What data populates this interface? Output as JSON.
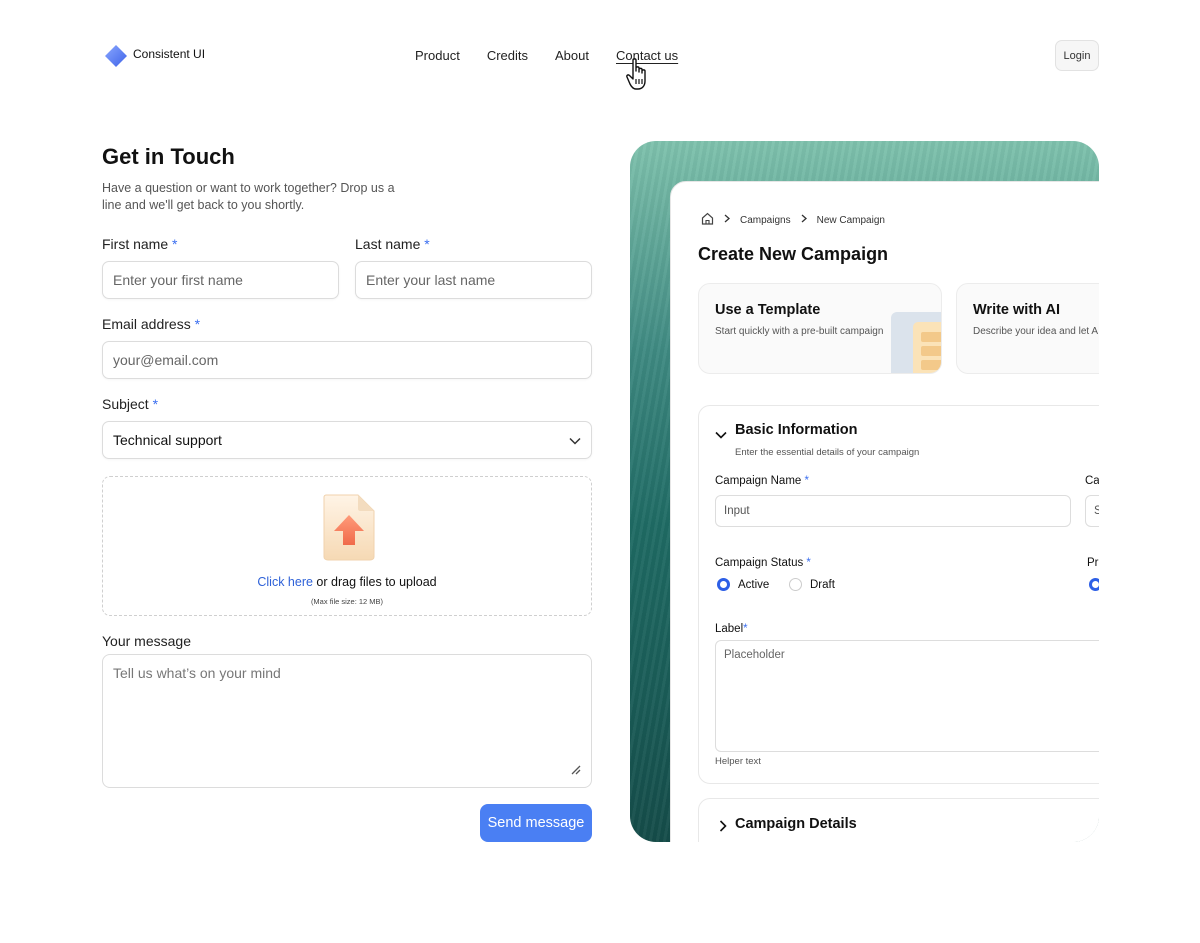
{
  "nav": {
    "brand": "Consistent UI",
    "items": [
      {
        "label": "Product"
      },
      {
        "label": "Credits"
      },
      {
        "label": "About"
      },
      {
        "label": "Contact us"
      }
    ],
    "active_item": "Contact us",
    "login": "Login"
  },
  "form": {
    "title": "Get in Touch",
    "subtitle": "Have a question or want to work together? Drop us a line and we'll get back to you shortly.",
    "required_mark": "*",
    "first_name": {
      "label": "First name",
      "placeholder": "Enter your first name"
    },
    "last_name": {
      "label": "Last name",
      "placeholder": "Enter your last name"
    },
    "email": {
      "label": "Email address",
      "placeholder": "your@email.com"
    },
    "subject": {
      "label": "Subject",
      "value": "Technical support"
    },
    "upload": {
      "link": "Click here",
      "text": " or drag files to upload",
      "note": "(Max file size: 12 MB)"
    },
    "message": {
      "label": "Your message",
      "placeholder": "Tell us what’s on your mind"
    },
    "submit": "Send message"
  },
  "preview": {
    "breadcrumb": [
      "Campaigns",
      "New Campaign"
    ],
    "title": "Create New Campaign",
    "options": [
      {
        "title": "Use a Template",
        "desc": "Start quickly with a pre-built campaign"
      },
      {
        "title": "Write with AI",
        "desc": "Describe your idea and let AI"
      }
    ],
    "basic": {
      "title": "Basic Information",
      "desc": "Enter the essential details of your campaign",
      "name_label": "Campaign Name",
      "name_placeholder": "Input",
      "cut_label": "Ca",
      "cut_input": "S",
      "status_label": "Campaign Status",
      "status_options": [
        "Active",
        "Draft"
      ],
      "selected_status": "Active",
      "cut_label2": "Pr",
      "label_label": "Label",
      "label_placeholder": "Placeholder",
      "helper": "Helper text"
    },
    "details": {
      "title": "Campaign Details"
    }
  },
  "colors": {
    "accent": "#4a7ff3",
    "required": "#3b6ff0",
    "link": "#2f62d8",
    "radio_on": "#2d5fe6",
    "preview_bg": "#1f6b64"
  }
}
